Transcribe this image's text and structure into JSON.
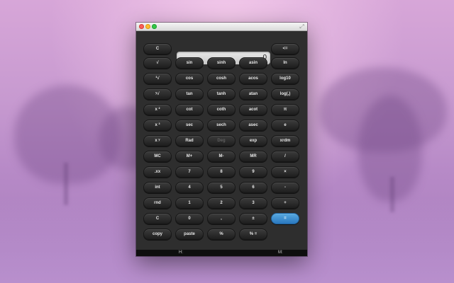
{
  "window": {
    "fullscreen_icon": "fullscreen-arrows-icon"
  },
  "display": {
    "value": "0"
  },
  "keys": [
    {
      "label": "C",
      "name": "clear-top-button"
    },
    {
      "label": "<=",
      "name": "backspace-button"
    },
    {
      "label": "√",
      "name": "sqrt-button"
    },
    {
      "label": "sin",
      "name": "sin-button"
    },
    {
      "label": "sinh",
      "name": "sinh-button"
    },
    {
      "label": "asin",
      "name": "asin-button"
    },
    {
      "label": "ln",
      "name": "ln-button"
    },
    {
      "label": "³√",
      "name": "cbrt-button"
    },
    {
      "label": "cos",
      "name": "cos-button"
    },
    {
      "label": "cosh",
      "name": "cosh-button"
    },
    {
      "label": "acos",
      "name": "acos-button"
    },
    {
      "label": "log10",
      "name": "log10-button"
    },
    {
      "label": "ʸ√",
      "name": "yroot-button"
    },
    {
      "label": "tan",
      "name": "tan-button"
    },
    {
      "label": "tanh",
      "name": "tanh-button"
    },
    {
      "label": "atan",
      "name": "atan-button"
    },
    {
      "label": "log(,)",
      "name": "logbase-button"
    },
    {
      "label": "x ²",
      "name": "square-button"
    },
    {
      "label": "cot",
      "name": "cot-button"
    },
    {
      "label": "coth",
      "name": "coth-button"
    },
    {
      "label": "acot",
      "name": "acot-button"
    },
    {
      "label": "π",
      "name": "pi-button"
    },
    {
      "label": "x ³",
      "name": "cube-button"
    },
    {
      "label": "sec",
      "name": "sec-button"
    },
    {
      "label": "sech",
      "name": "sech-button"
    },
    {
      "label": "asec",
      "name": "asec-button"
    },
    {
      "label": "e",
      "name": "e-button"
    },
    {
      "label": "x ʸ",
      "name": "power-button"
    },
    {
      "label": "Rad",
      "name": "rad-button"
    },
    {
      "label": "Deg",
      "name": "deg-button"
    },
    {
      "label": "exp",
      "name": "exp-button"
    },
    {
      "label": "xrdm",
      "name": "xrdm-button"
    },
    {
      "label": "MC",
      "name": "mc-button"
    },
    {
      "label": "M+",
      "name": "mplus-button"
    },
    {
      "label": "M-",
      "name": "mminus-button"
    },
    {
      "label": "MR",
      "name": "mr-button"
    },
    {
      "label": "/",
      "name": "divide-button"
    },
    {
      "label": ".xx",
      "name": "decimals-button"
    },
    {
      "label": "7",
      "name": "digit-7-button"
    },
    {
      "label": "8",
      "name": "digit-8-button"
    },
    {
      "label": "9",
      "name": "digit-9-button"
    },
    {
      "label": "×",
      "name": "multiply-button"
    },
    {
      "label": "int",
      "name": "int-button"
    },
    {
      "label": "4",
      "name": "digit-4-button"
    },
    {
      "label": "5",
      "name": "digit-5-button"
    },
    {
      "label": "6",
      "name": "digit-6-button"
    },
    {
      "label": "-",
      "name": "minus-button"
    },
    {
      "label": "rnd",
      "name": "rnd-button"
    },
    {
      "label": "1",
      "name": "digit-1-button"
    },
    {
      "label": "2",
      "name": "digit-2-button"
    },
    {
      "label": "3",
      "name": "digit-3-button"
    },
    {
      "label": "+",
      "name": "plus-button"
    },
    {
      "label": "C",
      "name": "clear-button"
    },
    {
      "label": "0",
      "name": "digit-0-button"
    },
    {
      "label": ",",
      "name": "comma-button"
    },
    {
      "label": "±",
      "name": "sign-button"
    },
    {
      "label": "=",
      "name": "equals-button"
    },
    {
      "label": "copy",
      "name": "copy-button"
    },
    {
      "label": "paste",
      "name": "paste-button"
    },
    {
      "label": "%",
      "name": "percent-button"
    },
    {
      "label": "% =",
      "name": "percent-equals-button"
    }
  ],
  "disabled_key": "Deg",
  "status": {
    "left": "H:",
    "right": "M:"
  },
  "colors": {
    "accent": "#2a78bf",
    "window": "#2e2e2e"
  }
}
